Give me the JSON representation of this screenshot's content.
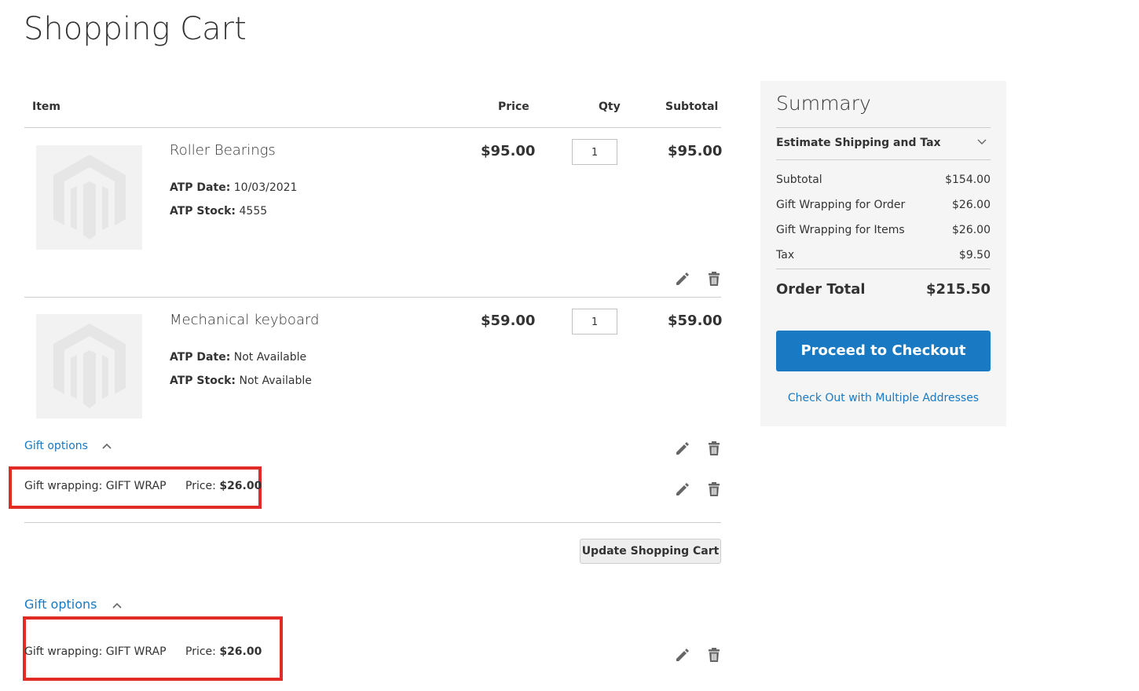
{
  "page": {
    "title": "Shopping Cart"
  },
  "table": {
    "headers": {
      "item": "Item",
      "price": "Price",
      "qty": "Qty",
      "subtotal": "Subtotal"
    }
  },
  "items": [
    {
      "name": "Roller Bearings",
      "price": "$95.00",
      "qty": "1",
      "subtotal": "$95.00",
      "atp_date_label": "ATP Date:",
      "atp_date": "10/03/2021",
      "atp_stock_label": "ATP Stock:",
      "atp_stock": "4555"
    },
    {
      "name": "Mechanical keyboard",
      "price": "$59.00",
      "qty": "1",
      "subtotal": "$59.00",
      "atp_date_label": "ATP Date:",
      "atp_date": "Not Available",
      "atp_stock_label": "ATP Stock:",
      "atp_stock": "Not Available",
      "gift_options_label": "Gift options",
      "gift_wrapping_label": "Gift wrapping: GIFT WRAP",
      "gift_price_label": "Price:",
      "gift_price": "$26.00"
    }
  ],
  "actions": {
    "update_cart": "Update Shopping Cart"
  },
  "order_gift": {
    "gift_options_label": "Gift options",
    "gift_wrapping_label": "Gift wrapping: GIFT WRAP",
    "gift_price_label": "Price:",
    "gift_price": "$26.00"
  },
  "summary": {
    "title": "Summary",
    "estimate_label": "Estimate Shipping and Tax",
    "rows": [
      {
        "label": "Subtotal",
        "value": "$154.00"
      },
      {
        "label": "Gift Wrapping for Order",
        "value": "$26.00"
      },
      {
        "label": "Gift Wrapping for Items",
        "value": "$26.00"
      },
      {
        "label": "Tax",
        "value": "$9.50"
      }
    ],
    "order_total_label": "Order Total",
    "order_total_value": "$215.50",
    "checkout_label": "Proceed to Checkout",
    "multi_address_label": "Check Out with Multiple Addresses"
  },
  "colors": {
    "accent": "#1979c3",
    "highlight": "#e02b27",
    "panel": "#f5f5f5"
  },
  "icons": [
    "edit-pencil-icon",
    "trash-icon",
    "chevron-up-icon",
    "chevron-down-icon",
    "product-placeholder-icon"
  ]
}
